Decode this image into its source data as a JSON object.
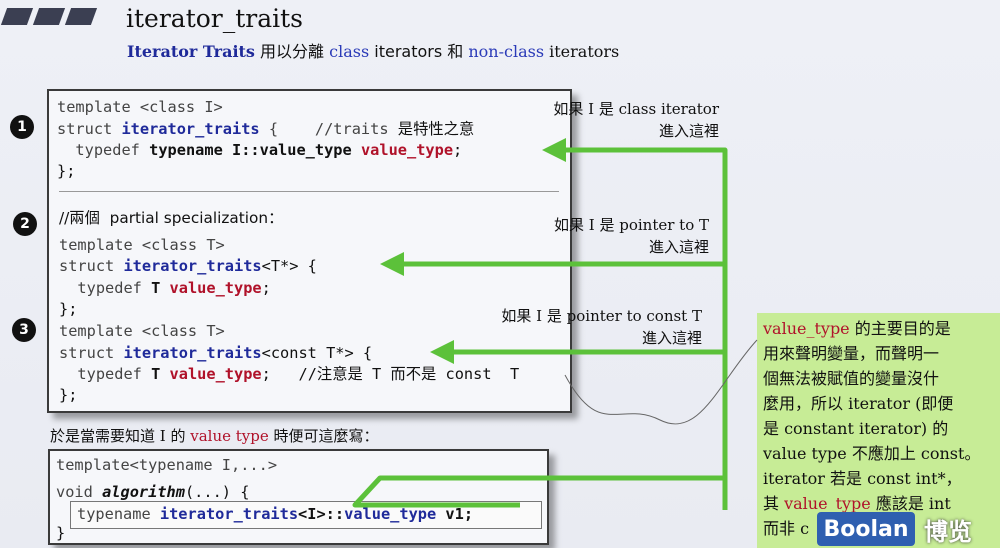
{
  "header": {
    "title": "iterator_traits",
    "subtitle_parts": [
      "Iterator Traits",
      " 用以分離 ",
      "class",
      " iterators 和 ",
      "non-class",
      " iterators"
    ]
  },
  "code_block_1": {
    "line1": "template <class I>",
    "line2_kw": "struct ",
    "line2_fn": "iterator_traits",
    "line2_rest": " {    //traits ",
    "line2_cjk": "是特性之意",
    "line3_kw": "  typedef ",
    "line3_bold": "typename I::value_type ",
    "line3_red": "value_type",
    "line3_end": ";",
    "line4": "};",
    "line5": "//兩個  partial specialization：",
    "line6": "template <class T>",
    "line7_kw": "struct ",
    "line7_fn": "iterator_traits",
    "line7_rest": "<T*> {",
    "line8_kw": "  typedef ",
    "line8_bold": "T ",
    "line8_red": "value_type",
    "line8_end": ";",
    "line9": "};",
    "line10": "template <class T>",
    "line11_kw": "struct ",
    "line11_fn": "iterator_traits",
    "line11_rest": "<const T*> {",
    "line12_kw": "  typedef ",
    "line12_bold": "T ",
    "line12_red": "value_type",
    "line12_end": ";   //注意是 T 而不是 const  T",
    "line13": "};"
  },
  "markers": [
    "1",
    "2",
    "3"
  ],
  "notes": {
    "n1_a": "如果 I 是 class iterator",
    "n1_b": "進入這裡",
    "n2_a": "如果 I 是 pointer to T",
    "n2_b": "進入這裡",
    "n3_a": "如果 I 是 pointer to const T",
    "n3_b": "進入這裡"
  },
  "question": {
    "prefix": "於是當需要知道 I 的 ",
    "vt": "value type",
    "suffix": " 時便可這麼寫："
  },
  "code_block_2": {
    "line1": "template<typename I,...>",
    "line2_kw": "void ",
    "line2_fn": "algorithm",
    "line2_rest": "(...) {",
    "line3_kw": "typename ",
    "line3_fn": "iterator_traits",
    "line3_mid": "<I>::",
    "line3_red": "value_type",
    "line3_end": " v1;",
    "line4": "}"
  },
  "explanation": {
    "l1_red": "value_type",
    "l1_rest": " 的主要目的是",
    "l2": "用來聲明變量，而聲明一",
    "l3": "個無法被賦值的變量沒什",
    "l4": "麼用，所以 iterator (即便",
    "l5": "是 constant iterator) 的",
    "l6": "value type 不應加上 const。",
    "l7": "iterator 若是 const int*，",
    "l8_pre": "其 ",
    "l8_red": "value_type",
    "l8_rest": " 應該是 int",
    "l9": "而非 c"
  },
  "brand": {
    "logo": "Boolan",
    "name": "博览"
  },
  "colors": {
    "arrow": "#5cc13a",
    "highlight_box": "#c7ec96",
    "accent_red": "#b0122a",
    "accent_blue": "#1f2a9a"
  }
}
